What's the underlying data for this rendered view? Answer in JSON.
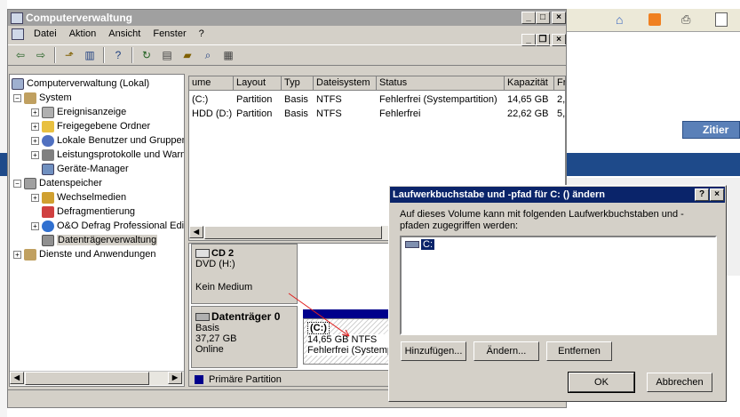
{
  "main_window": {
    "title": "Computerverwaltung",
    "menu": [
      "Datei",
      "Aktion",
      "Ansicht",
      "Fenster",
      "?"
    ]
  },
  "tree": [
    {
      "label": "Computerverwaltung (Lokal)",
      "level": 0
    },
    {
      "label": "System",
      "level": 1
    },
    {
      "label": "Ereignisanzeige",
      "level": 2
    },
    {
      "label": "Freigegebene Ordner",
      "level": 2
    },
    {
      "label": "Lokale Benutzer und Gruppen",
      "level": 2
    },
    {
      "label": "Leistungsprotokolle und Warnungen",
      "level": 2
    },
    {
      "label": "Geräte-Manager",
      "level": 2
    },
    {
      "label": "Datenspeicher",
      "level": 1
    },
    {
      "label": "Wechselmedien",
      "level": 2
    },
    {
      "label": "Defragmentierung",
      "level": 2
    },
    {
      "label": "O&O Defrag Professional Edition",
      "level": 2
    },
    {
      "label": "Datenträgerverwaltung",
      "level": 2
    },
    {
      "label": "Dienste und Anwendungen",
      "level": 1
    }
  ],
  "volume_table": {
    "headers": [
      "ume",
      "Layout",
      "Typ",
      "Dateisystem",
      "Status",
      "Kapazität",
      "Fr"
    ],
    "rows": [
      [
        "(C:)",
        "Partition",
        "Basis",
        "NTFS",
        "Fehlerfrei (Systempartition)",
        "14,65 GB",
        "2,"
      ],
      [
        "HDD (D:)",
        "Partition",
        "Basis",
        "NTFS",
        "Fehlerfrei",
        "22,62 GB",
        "5,"
      ]
    ]
  },
  "disks": {
    "cd": {
      "name": "CD 2",
      "type": "DVD (H:)",
      "media": "Kein Medium"
    },
    "disk0": {
      "name": "Datenträger 0",
      "type": "Basis",
      "size": "37,27 GB",
      "state": "Online"
    },
    "partition": {
      "name": "(C:)",
      "size": "14,65 GB NTFS",
      "status": "Fehlerfrei (Systemp"
    }
  },
  "legend": {
    "primary": "Primäre Partition"
  },
  "dialog": {
    "title": "Laufwerkbuchstabe und -pfad für C: () ändern",
    "description": "Auf dieses Volume kann mit folgenden Laufwerkbuchstaben und -pfaden zugegriffen werden:",
    "list_items": [
      "C:"
    ],
    "add_label": "Hinzufügen...",
    "change_label": "Ändern...",
    "remove_label": "Entfernen",
    "ok_label": "OK",
    "cancel_label": "Abbrechen"
  },
  "browser_bg": {
    "zitier_label": "Zitier"
  },
  "colors": {
    "title_active": "#0a246a",
    "title_inactive": "#a0a0a0",
    "partition_bar": "#00008b",
    "face": "#d4d0c8"
  }
}
